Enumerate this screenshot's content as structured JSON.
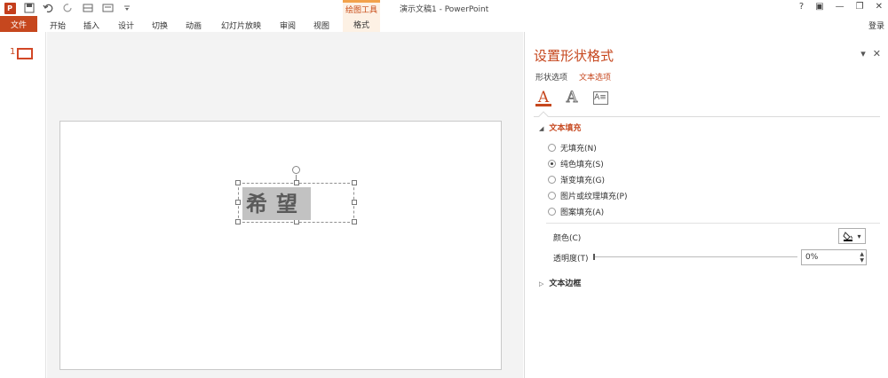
{
  "window": {
    "app_title": "演示文稿1 - PowerPoint",
    "contextual_group": "绘图工具",
    "controls": [
      "?",
      "▣",
      "—",
      "❐",
      "✕"
    ]
  },
  "qat": {
    "logo": "P",
    "icons": [
      "save-icon",
      "undo-icon",
      "redo-icon",
      "draw-table-icon",
      "presentation-icon",
      "customize-icon"
    ]
  },
  "ribbon": {
    "file_tab": "文件",
    "tabs": [
      "开始",
      "插入",
      "设计",
      "切换",
      "动画",
      "幻灯片放映",
      "审阅",
      "视图"
    ],
    "format_tab": "格式",
    "login": "登录"
  },
  "thumbnails": {
    "slide_number": "1"
  },
  "slide": {
    "text": "希望"
  },
  "format_pane": {
    "title": "设置形状格式",
    "subtabs": [
      "形状选项",
      "文本选项"
    ],
    "active_subtab": "文本选项",
    "text_fill": {
      "header": "文本填充",
      "options": [
        "无填充(N)",
        "纯色填充(S)",
        "渐变填充(G)",
        "图片或纹理填充(P)",
        "图案填充(A)"
      ],
      "selected": "纯色填充(S)"
    },
    "color_label": "颜色(C)",
    "transparency_label": "透明度(T)",
    "transparency_value": "0%",
    "transparency_fraction": 0.0,
    "text_border": "文本边框"
  },
  "colors": {
    "accent": "#c6471e",
    "contextual_border": "#f2a24b"
  }
}
